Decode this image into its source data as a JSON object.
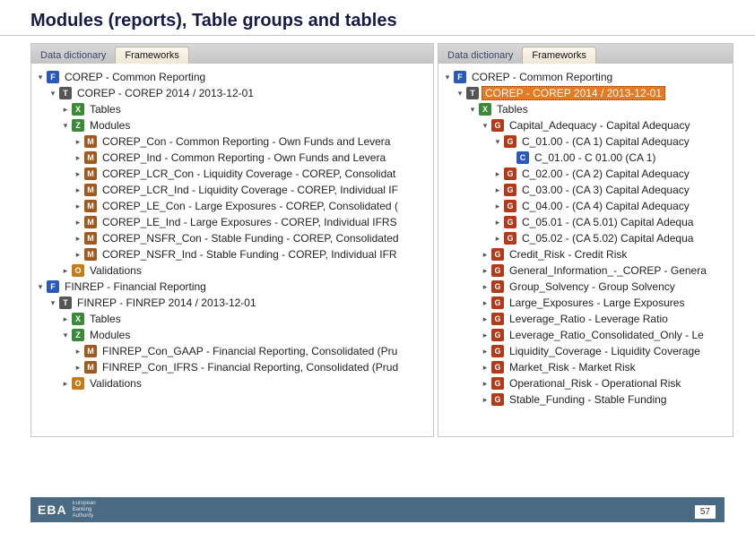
{
  "title": "Modules (reports), Table groups and tables",
  "tabs": {
    "data_dictionary": "Data dictionary",
    "frameworks": "Frameworks"
  },
  "footer": {
    "logo": "EBA",
    "sub1": "European",
    "sub2": "Banking",
    "sub3": "Authority"
  },
  "page_number": "57",
  "left_tree": [
    {
      "d": 0,
      "e": "open",
      "i": "F",
      "t": "COREP - Common Reporting"
    },
    {
      "d": 1,
      "e": "open",
      "i": "T",
      "t": "COREP - COREP 2014 / 2013-12-01"
    },
    {
      "d": 2,
      "e": "closed",
      "i": "X",
      "t": "Tables"
    },
    {
      "d": 2,
      "e": "open",
      "i": "Z",
      "t": "Modules"
    },
    {
      "d": 3,
      "e": "closed",
      "i": "M",
      "t": "COREP_Con - Common Reporting - Own Funds and Levera"
    },
    {
      "d": 3,
      "e": "closed",
      "i": "M",
      "t": "COREP_Ind - Common Reporting - Own Funds and Levera"
    },
    {
      "d": 3,
      "e": "closed",
      "i": "M",
      "t": "COREP_LCR_Con - Liquidity Coverage - COREP, Consolidat"
    },
    {
      "d": 3,
      "e": "closed",
      "i": "M",
      "t": "COREP_LCR_Ind - Liquidity Coverage - COREP, Individual IF"
    },
    {
      "d": 3,
      "e": "closed",
      "i": "M",
      "t": "COREP_LE_Con - Large Exposures - COREP, Consolidated ("
    },
    {
      "d": 3,
      "e": "closed",
      "i": "M",
      "t": "COREP_LE_Ind - Large Exposures - COREP, Individual IFRS"
    },
    {
      "d": 3,
      "e": "closed",
      "i": "M",
      "t": "COREP_NSFR_Con - Stable Funding - COREP, Consolidated"
    },
    {
      "d": 3,
      "e": "closed",
      "i": "M",
      "t": "COREP_NSFR_Ind - Stable Funding - COREP, Individual IFR"
    },
    {
      "d": 2,
      "e": "closed",
      "i": "O",
      "t": "Validations"
    },
    {
      "d": 0,
      "e": "open",
      "i": "F",
      "t": "FINREP - Financial Reporting"
    },
    {
      "d": 1,
      "e": "open",
      "i": "T",
      "t": "FINREP - FINREP 2014 / 2013-12-01"
    },
    {
      "d": 2,
      "e": "closed",
      "i": "X",
      "t": "Tables"
    },
    {
      "d": 2,
      "e": "open",
      "i": "Z",
      "t": "Modules"
    },
    {
      "d": 3,
      "e": "closed",
      "i": "M",
      "t": "FINREP_Con_GAAP - Financial Reporting, Consolidated (Pru"
    },
    {
      "d": 3,
      "e": "closed",
      "i": "M",
      "t": "FINREP_Con_IFRS - Financial Reporting, Consolidated (Prud"
    },
    {
      "d": 2,
      "e": "closed",
      "i": "O",
      "t": "Validations"
    }
  ],
  "right_tree": [
    {
      "d": 0,
      "e": "open",
      "i": "F",
      "t": "COREP - Common Reporting"
    },
    {
      "d": 1,
      "e": "open",
      "i": "T",
      "t": "COREP - COREP 2014 / 2013-12-01",
      "sel": true
    },
    {
      "d": 2,
      "e": "open",
      "i": "X",
      "t": "Tables"
    },
    {
      "d": 3,
      "e": "open",
      "i": "G",
      "t": "Capital_Adequacy - Capital Adequacy"
    },
    {
      "d": 4,
      "e": "open",
      "i": "G",
      "t": "C_01.00 - (CA 1) Capital Adequacy"
    },
    {
      "d": 5,
      "e": "none",
      "i": "C",
      "t": "C_01.00 - C 01.00 (CA 1)"
    },
    {
      "d": 4,
      "e": "closed",
      "i": "G",
      "t": "C_02.00 - (CA 2) Capital Adequacy"
    },
    {
      "d": 4,
      "e": "closed",
      "i": "G",
      "t": "C_03.00 - (CA 3) Capital Adequacy"
    },
    {
      "d": 4,
      "e": "closed",
      "i": "G",
      "t": "C_04.00 - (CA 4) Capital Adequacy"
    },
    {
      "d": 4,
      "e": "closed",
      "i": "G",
      "t": "C_05.01 - (CA 5.01) Capital Adequa"
    },
    {
      "d": 4,
      "e": "closed",
      "i": "G",
      "t": "C_05.02 - (CA 5.02) Capital Adequa"
    },
    {
      "d": 3,
      "e": "closed",
      "i": "G",
      "t": "Credit_Risk - Credit Risk"
    },
    {
      "d": 3,
      "e": "closed",
      "i": "G",
      "t": "General_Information_-_COREP - Genera"
    },
    {
      "d": 3,
      "e": "closed",
      "i": "G",
      "t": "Group_Solvency - Group Solvency"
    },
    {
      "d": 3,
      "e": "closed",
      "i": "G",
      "t": "Large_Exposures - Large Exposures"
    },
    {
      "d": 3,
      "e": "closed",
      "i": "G",
      "t": "Leverage_Ratio - Leverage Ratio"
    },
    {
      "d": 3,
      "e": "closed",
      "i": "G",
      "t": "Leverage_Ratio_Consolidated_Only - Le"
    },
    {
      "d": 3,
      "e": "closed",
      "i": "G",
      "t": "Liquidity_Coverage - Liquidity Coverage"
    },
    {
      "d": 3,
      "e": "closed",
      "i": "G",
      "t": "Market_Risk - Market Risk"
    },
    {
      "d": 3,
      "e": "closed",
      "i": "G",
      "t": "Operational_Risk - Operational Risk"
    },
    {
      "d": 3,
      "e": "closed",
      "i": "G",
      "t": "Stable_Funding - Stable Funding"
    }
  ]
}
